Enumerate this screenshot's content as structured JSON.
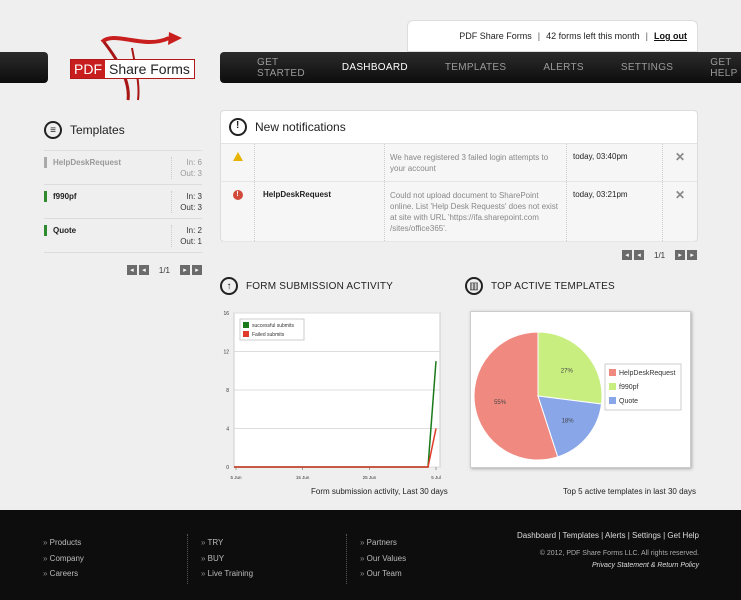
{
  "account": {
    "brand": "PDF Share Forms",
    "forms_left": "42 forms left this month",
    "logout": "Log out"
  },
  "logo": {
    "pdf": "PDF",
    "share_forms": "Share Forms"
  },
  "nav": [
    {
      "label": "GET STARTED"
    },
    {
      "label": "DASHBOARD"
    },
    {
      "label": "TEMPLATES"
    },
    {
      "label": "ALERTS"
    },
    {
      "label": "SETTINGS"
    },
    {
      "label": "GET HELP"
    }
  ],
  "sidebar": {
    "title": "Templates",
    "items": [
      {
        "name": "HelpDeskRequest",
        "in": "In: 6",
        "out": "Out: 3"
      },
      {
        "name": "f990pf",
        "in": "In: 3",
        "out": "Out: 3"
      },
      {
        "name": "Quote",
        "in": "In: 2",
        "out": "Out: 1"
      }
    ],
    "page": "1/1"
  },
  "notifications": {
    "title": "New notifications",
    "rows": [
      {
        "template": "",
        "message": "We have registered 3 failed login attempts to your account",
        "time": "today, 03:40pm"
      },
      {
        "template": "HelpDeskRequest",
        "message": "Could not upload document to SharePoint online. List 'Help Desk Requests' does not exist at site with URL 'https://ifa.sharepoint.com /sites/office365'.",
        "time": "today, 03:21pm"
      }
    ],
    "page": "1/1"
  },
  "activity": {
    "title": "FORM SUBMISSION ACTIVITY",
    "caption": "Form submission activity, Last 30 days"
  },
  "top_templates": {
    "title": "TOP ACTIVE TEMPLATES",
    "caption": "Top 5 active templates in last 30 days"
  },
  "chart_data": [
    {
      "type": "line",
      "x": [
        "5 Jun",
        "15 Jun",
        "25 Jun",
        "5 Jul"
      ],
      "yticks": [
        0,
        4,
        8,
        12,
        16
      ],
      "ylim": [
        0,
        16
      ],
      "series": [
        {
          "name": "successful submits",
          "color": "#1a7a1a",
          "values": [
            0,
            0,
            0,
            0,
            0,
            11
          ]
        },
        {
          "name": "Failed submits",
          "color": "#e03a2a",
          "values": [
            0,
            0,
            0,
            0,
            0,
            4
          ]
        }
      ],
      "grid": true,
      "legend": "top-left"
    },
    {
      "type": "pie",
      "slices": [
        {
          "label": "HelpDeskRequest",
          "value": 55,
          "text": "55%",
          "color": "#f08a80"
        },
        {
          "label": "f990pf",
          "value": 27,
          "text": "27%",
          "color": "#c8ee80"
        },
        {
          "label": "Quote",
          "value": 18,
          "text": "18%",
          "color": "#88a6e8"
        }
      ],
      "legend": "right"
    }
  ],
  "footer": {
    "col1": [
      "Products",
      "Company",
      "Careers"
    ],
    "col2": [
      "TRY",
      "BUY",
      "Live Training"
    ],
    "col3": [
      "Partners",
      "Our Values",
      "Our Team"
    ],
    "links": "Dashboard | Templates | Alerts | Settings | Get Help",
    "copyright": "© 2012, PDF Share Forms LLC. All rights reserved.",
    "policy": "Privacy Statement & Return Policy"
  }
}
